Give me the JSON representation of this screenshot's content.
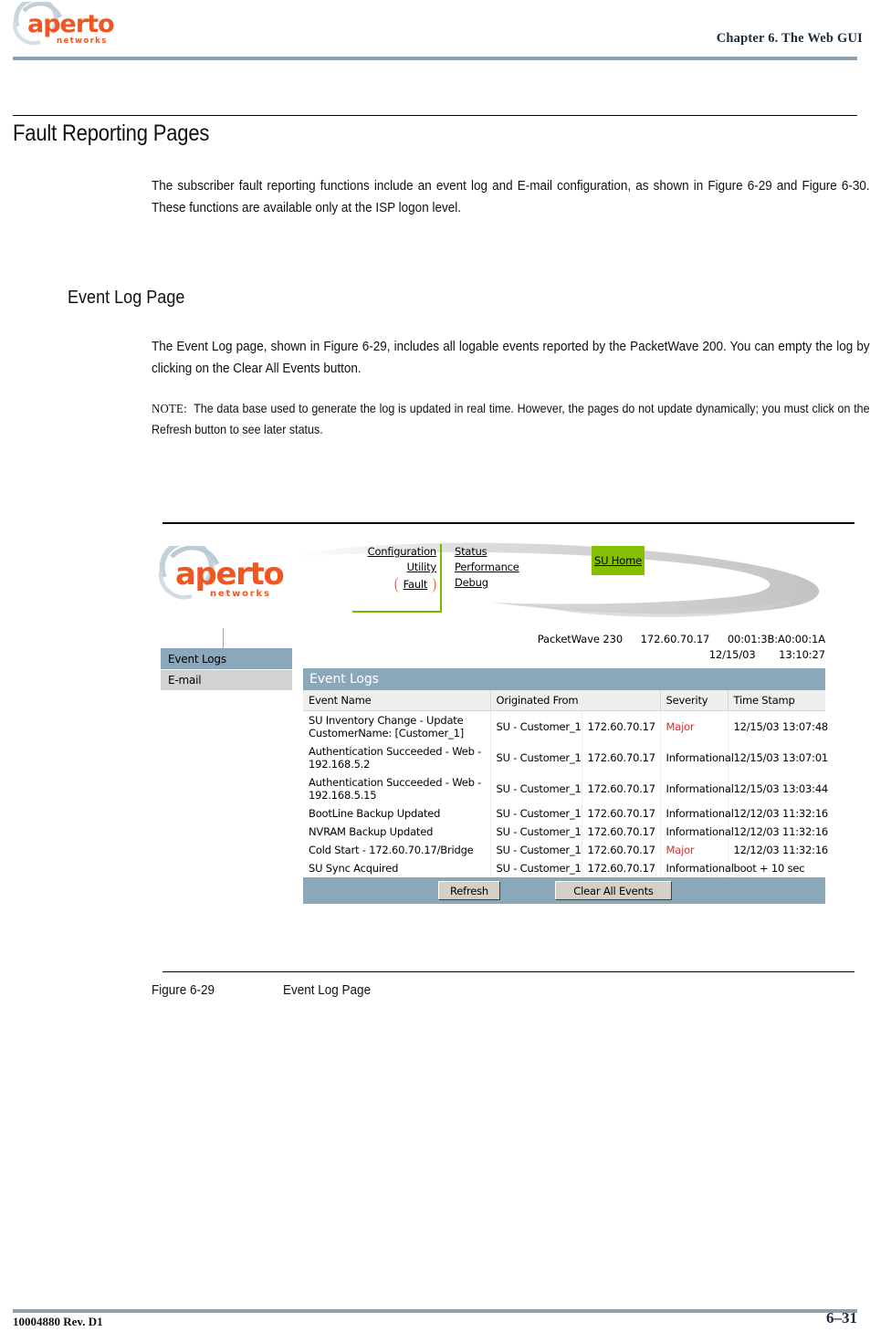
{
  "page": {
    "header": {
      "logo_name": "aperto-networks-logo",
      "logo_word": "aperto",
      "logo_sub": "n e t w o r k s",
      "chapter": "Chapter 6.  The Web GUI"
    },
    "footer": {
      "doc_id": "10004880 Rev. D1",
      "page_number": "6–31"
    }
  },
  "content": {
    "section_title": "Fault Reporting Pages",
    "intro_paragraph": "The subscriber fault reporting functions include an event log and E-mail configuration, as shown in Figure 6-29 and Figure 6-30. These functions are available only at the ISP logon level.",
    "subsection_title": "Event Log Page",
    "subsection_paragraph": "The Event Log page, shown in Figure 6-29, includes all logable events reported by the PacketWave 200. You can empty the log by clicking on the Clear All Events button.",
    "note_label": "NOTE:",
    "note_text": "The data base used to generate the log is updated in real time. However, the pages do not update dynamically; you must click on the Refresh button to see later status.",
    "figure_caption_number": "Figure 6-29",
    "figure_caption_title": "Event Log Page"
  },
  "screenshot": {
    "brand": {
      "logo_name": "aperto-networks-logo",
      "logo_word": "aperto",
      "logo_sub": "n e t w o r k s"
    },
    "nav_primary": [
      {
        "label": "Configuration",
        "selected": false
      },
      {
        "label": "Utility",
        "selected": false
      },
      {
        "label": "Fault",
        "selected": true
      }
    ],
    "nav_secondary": [
      {
        "label": "Status"
      },
      {
        "label": "Performance"
      },
      {
        "label": "Debug"
      }
    ],
    "su_home_label": "SU Home",
    "su_home_color": "#84c000",
    "device_info": {
      "model": "PacketWave 230",
      "ip": "172.60.70.17",
      "mac": "00:01:3B:A0:00:1A",
      "date": "12/15/03",
      "time": "13:10:27"
    },
    "sidebar": [
      {
        "label": "Event Logs",
        "selected": true
      },
      {
        "label": "E-mail",
        "selected": false
      }
    ],
    "panel": {
      "title": "Event Logs",
      "columns": [
        "Event Name",
        "Originated From",
        "",
        "Severity",
        "Time Stamp"
      ],
      "rows": [
        {
          "event_name": "SU Inventory Change - Update CustomerName: [Customer_1]",
          "originated_from": "SU - Customer_1",
          "ip": "172.60.70.17",
          "severity": "Major",
          "severity_kind": "major",
          "time_stamp": "12/15/03 13:07:48"
        },
        {
          "event_name": "Authentication Succeeded - Web - 192.168.5.2",
          "originated_from": "SU - Customer_1",
          "ip": "172.60.70.17",
          "severity": "Informational",
          "severity_kind": "info",
          "time_stamp": "12/15/03 13:07:01"
        },
        {
          "event_name": "Authentication Succeeded - Web - 192.168.5.15",
          "originated_from": "SU - Customer_1",
          "ip": "172.60.70.17",
          "severity": "Informational",
          "severity_kind": "info",
          "time_stamp": "12/15/03 13:03:44"
        },
        {
          "event_name": "BootLine Backup Updated",
          "originated_from": "SU - Customer_1",
          "ip": "172.60.70.17",
          "severity": "Informational",
          "severity_kind": "info",
          "time_stamp": "12/12/03 11:32:16"
        },
        {
          "event_name": "NVRAM Backup Updated",
          "originated_from": "SU - Customer_1",
          "ip": "172.60.70.17",
          "severity": "Informational",
          "severity_kind": "info",
          "time_stamp": "12/12/03 11:32:16"
        },
        {
          "event_name": "Cold Start - 172.60.70.17/Bridge",
          "originated_from": "SU - Customer_1",
          "ip": "172.60.70.17",
          "severity": "Major",
          "severity_kind": "major",
          "time_stamp": "12/12/03 11:32:16"
        },
        {
          "event_name": "SU Sync Acquired",
          "originated_from": "SU - Customer_1",
          "ip": "172.60.70.17",
          "severity": "Informational",
          "severity_kind": "info",
          "time_stamp": "boot + 10 sec"
        }
      ],
      "buttons": {
        "refresh": "Refresh",
        "clear_all": "Clear All Events"
      },
      "header_color": "#8ba7ba",
      "major_color": "#e8262d"
    }
  }
}
